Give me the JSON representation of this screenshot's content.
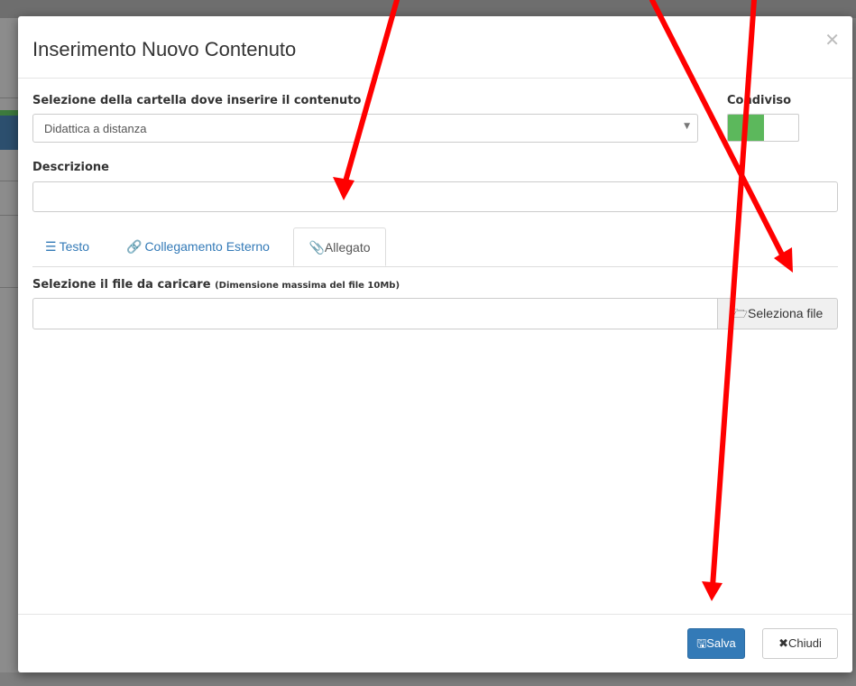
{
  "modal": {
    "title": "Inserimento Nuovo Contenuto",
    "close_icon": "close-icon"
  },
  "folder": {
    "label": "Selezione della cartella dove inserire il contenuto",
    "selected": "Didattica a distanza"
  },
  "shared": {
    "label": "Condiviso",
    "state_on": true,
    "on_color": "#5cb85c"
  },
  "description": {
    "label": "Descrizione",
    "value": ""
  },
  "tabs": [
    {
      "label": "Testo",
      "icon": "text-lines-icon",
      "active": false
    },
    {
      "label": "Collegamento Esterno",
      "icon": "link-icon",
      "active": false
    },
    {
      "label": "Allegato",
      "icon": "paperclip-icon",
      "active": true
    }
  ],
  "file": {
    "label": "Selezione il file da caricare",
    "hint": "(Dimensione massima del file 10Mb)",
    "value": "",
    "button_label": "Seleziona file",
    "button_icon": "folder-open-icon"
  },
  "footer": {
    "save_label": "Salva",
    "save_icon": "floppy-disk-icon",
    "close_label": "Chiudi",
    "close_icon": "times-icon"
  },
  "colors": {
    "primary": "#337ab7",
    "annotation_arrow": "#ff0000"
  }
}
